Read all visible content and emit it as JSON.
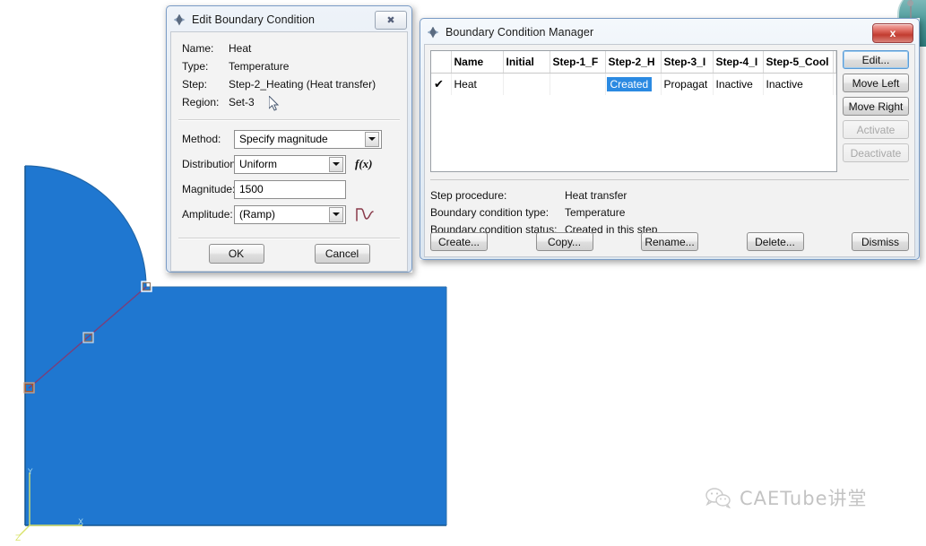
{
  "edit_dialog": {
    "title": "Edit Boundary Condition",
    "icon": "abaqus-diamond-icon",
    "close_label": "✖",
    "info": [
      {
        "label": "Name:",
        "value": "Heat"
      },
      {
        "label": "Type:",
        "value": "Temperature"
      },
      {
        "label": "Step:",
        "value": "Step-2_Heating (Heat transfer)"
      },
      {
        "label": "Region:",
        "value": "Set-3"
      }
    ],
    "fields": {
      "method": {
        "label": "Method:",
        "value": "Specify magnitude"
      },
      "distribution": {
        "label": "Distribution:",
        "value": "Uniform",
        "aux_icon": "f(x)"
      },
      "magnitude": {
        "label": "Magnitude:",
        "value": "1500"
      },
      "amplitude": {
        "label": "Amplitude:",
        "value": "(Ramp)",
        "aux_icon": "amplitude-wave-icon"
      }
    },
    "ok_label": "OK",
    "cancel_label": "Cancel"
  },
  "manager": {
    "title": "Boundary Condition Manager",
    "icon": "abaqus-diamond-icon",
    "close_label": "x",
    "table": {
      "columns": [
        "",
        "Name",
        "Initial",
        "Step-1_F",
        "Step-2_H",
        "Step-3_I",
        "Step-4_I",
        "Step-5_Cool"
      ],
      "rows": [
        {
          "check": "✔",
          "name": "Heat",
          "initial": "",
          "step1": "",
          "step2": "Created",
          "step2_selected": true,
          "step3": "Propagat",
          "step4": "Inactive",
          "step5": "Inactive"
        }
      ]
    },
    "side_buttons": [
      {
        "label": "Edit...",
        "state": "focused"
      },
      {
        "label": "Move Left",
        "state": "enabled"
      },
      {
        "label": "Move Right",
        "state": "enabled"
      },
      {
        "label": "Activate",
        "state": "disabled"
      },
      {
        "label": "Deactivate",
        "state": "disabled"
      }
    ],
    "status": [
      {
        "label": "Step procedure:",
        "value": "Heat transfer"
      },
      {
        "label": "Boundary condition type:",
        "value": "Temperature"
      },
      {
        "label": "Boundary condition status:",
        "value": "Created in this step"
      }
    ],
    "footer_buttons": [
      "Create...",
      "Copy...",
      "Rename...",
      "Delete...",
      "Dismiss"
    ]
  },
  "viewport": {
    "model_color": "#1f77d0",
    "edge_color": "#7a3f7a",
    "axis_labels": {
      "x": "X",
      "y": "Y",
      "z": "Z"
    }
  },
  "watermark": {
    "icon": "wechat-icon",
    "text": "CAETube讲堂"
  }
}
